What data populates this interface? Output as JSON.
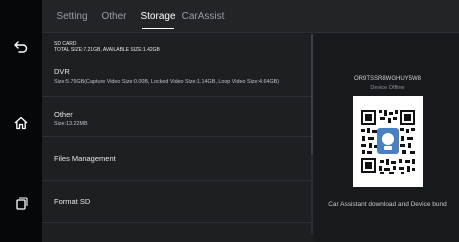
{
  "tabs": [
    {
      "label": "Setting",
      "active": false
    },
    {
      "label": "Other",
      "active": false
    },
    {
      "label": "Storage",
      "active": true
    },
    {
      "label": "CarAssist",
      "active": false
    }
  ],
  "sidebar": {
    "icons": [
      "back-icon",
      "home-icon",
      "recent-apps-icon"
    ]
  },
  "sd_card": {
    "title": "SD CARD",
    "summary": "TOTAL SIZE:7.21GB, AVAILABLE SIZE:1.42GB"
  },
  "rows": {
    "dvr": {
      "title": "DVR",
      "detail": "Size:5.79GB(Capture Video Size:0.00B, Locked Video Size:1.14GB, Loop Video Size:4.64GB)"
    },
    "other": {
      "title": "Other",
      "detail": "Size:13.22MB"
    },
    "files": {
      "title": "Files Management"
    },
    "format": {
      "title": "Format SD"
    }
  },
  "device": {
    "id": "OR9TSSR8WGHUY5W8",
    "status": "Device Offline",
    "qr_caption": "Car Assistant download and Device bund"
  },
  "colors": {
    "background": "#1a1b1f",
    "sidebar": "#060709",
    "text": "#e6e6e6",
    "qr_accent": "#4a7fc1"
  }
}
